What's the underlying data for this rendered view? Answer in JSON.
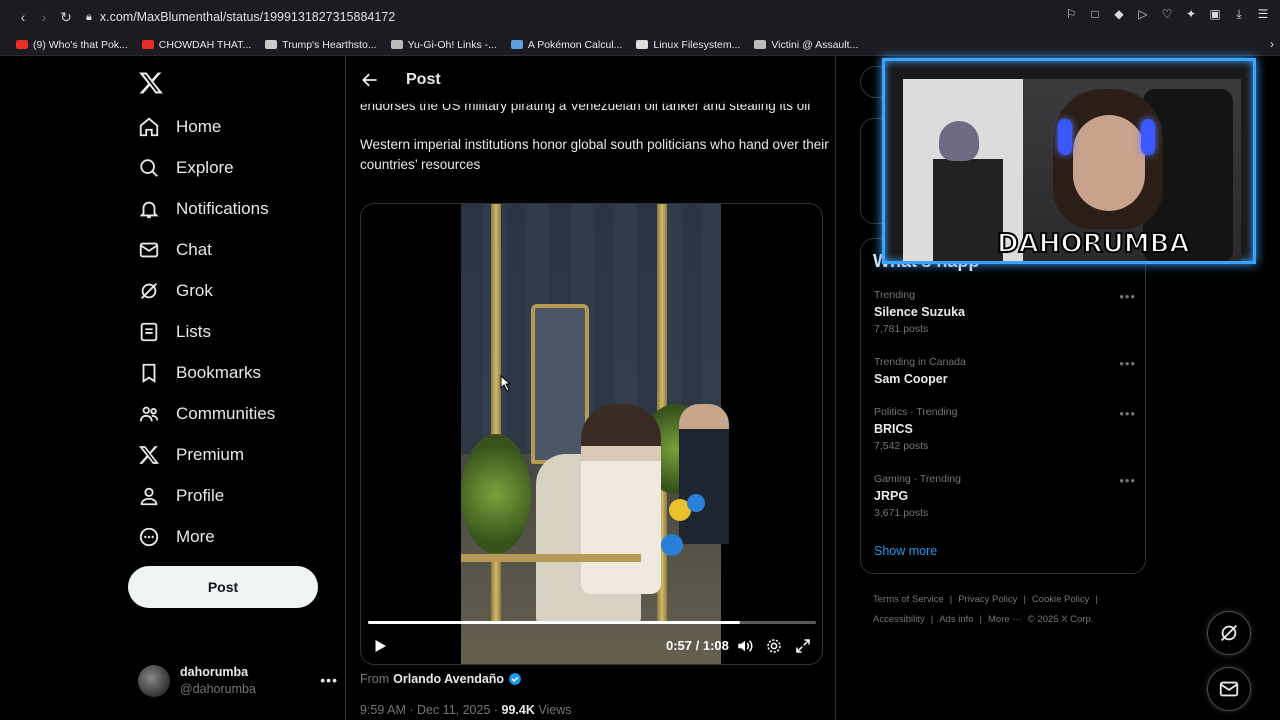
{
  "browser": {
    "url": "x.com/MaxBlumenthal/status/1999131827315884172",
    "bookmarks": [
      {
        "label": "(9) Who's that Pok...",
        "color": "#e52d27"
      },
      {
        "label": "CHOWDAH THAT...",
        "color": "#e52d27"
      },
      {
        "label": "Trump's Hearthsto...",
        "color": "#c9c9c9"
      },
      {
        "label": "Yu-Gi-Oh! Links -...",
        "color": "#bbbbbb"
      },
      {
        "label": "A Pokémon Calcul...",
        "color": "#5aa0e0"
      },
      {
        "label": "Linux Filesystem...",
        "color": "#dddddd"
      },
      {
        "label": "Victini @ Assault...",
        "color": "#bbbbbb"
      }
    ]
  },
  "nav": {
    "items": [
      {
        "label": "Home",
        "icon": "home-icon"
      },
      {
        "label": "Explore",
        "icon": "search-icon"
      },
      {
        "label": "Notifications",
        "icon": "bell-icon"
      },
      {
        "label": "Chat",
        "icon": "mail-icon"
      },
      {
        "label": "Grok",
        "icon": "grok-icon"
      },
      {
        "label": "Lists",
        "icon": "list-icon"
      },
      {
        "label": "Bookmarks",
        "icon": "bookmark-icon"
      },
      {
        "label": "Communities",
        "icon": "communities-icon"
      },
      {
        "label": "Premium",
        "icon": "x-logo-icon"
      },
      {
        "label": "Profile",
        "icon": "person-icon"
      },
      {
        "label": "More",
        "icon": "more-circle-icon"
      }
    ],
    "post_button": "Post",
    "account": {
      "name": "dahorumba",
      "handle": "@dahorumba"
    }
  },
  "post": {
    "header_title": "Post",
    "text_partial": "endorses the US military pirating a Venezuelan oil tanker and stealing its oil",
    "text_2": "Western imperial institutions honor global south politicians who hand over their countries’ resources",
    "video": {
      "time": "0:57 / 1:08",
      "progress": 0.83
    },
    "from_prefix": "From",
    "from_source": "Orlando Avendaño",
    "meta_time": "9:59 AM · Dec 11, 2025 ·",
    "views_count": "99.4K",
    "views_label": "Views"
  },
  "sidebar": {
    "title_partial": "What’s happ",
    "trends": [
      {
        "category": "Trending",
        "name": "Silence Suzuka",
        "count": "7,781 posts"
      },
      {
        "category": "Trending in Canada",
        "name": "Sam Cooper",
        "count": ""
      },
      {
        "category": "Politics · Trending",
        "name": "BRICS",
        "count": "7,542 posts"
      },
      {
        "category": "Gaming · Trending",
        "name": "JRPG",
        "count": "3,671 posts"
      }
    ],
    "show_more": "Show more",
    "footer": [
      "Terms of Service",
      "|",
      "Privacy Policy",
      "|",
      "Cookie Policy",
      "|",
      "Accessibility",
      "|",
      "Ads info",
      "|",
      "More ···",
      "© 2025 X Corp."
    ]
  },
  "overlay": {
    "streamer_name": "DAHORUMBA"
  }
}
